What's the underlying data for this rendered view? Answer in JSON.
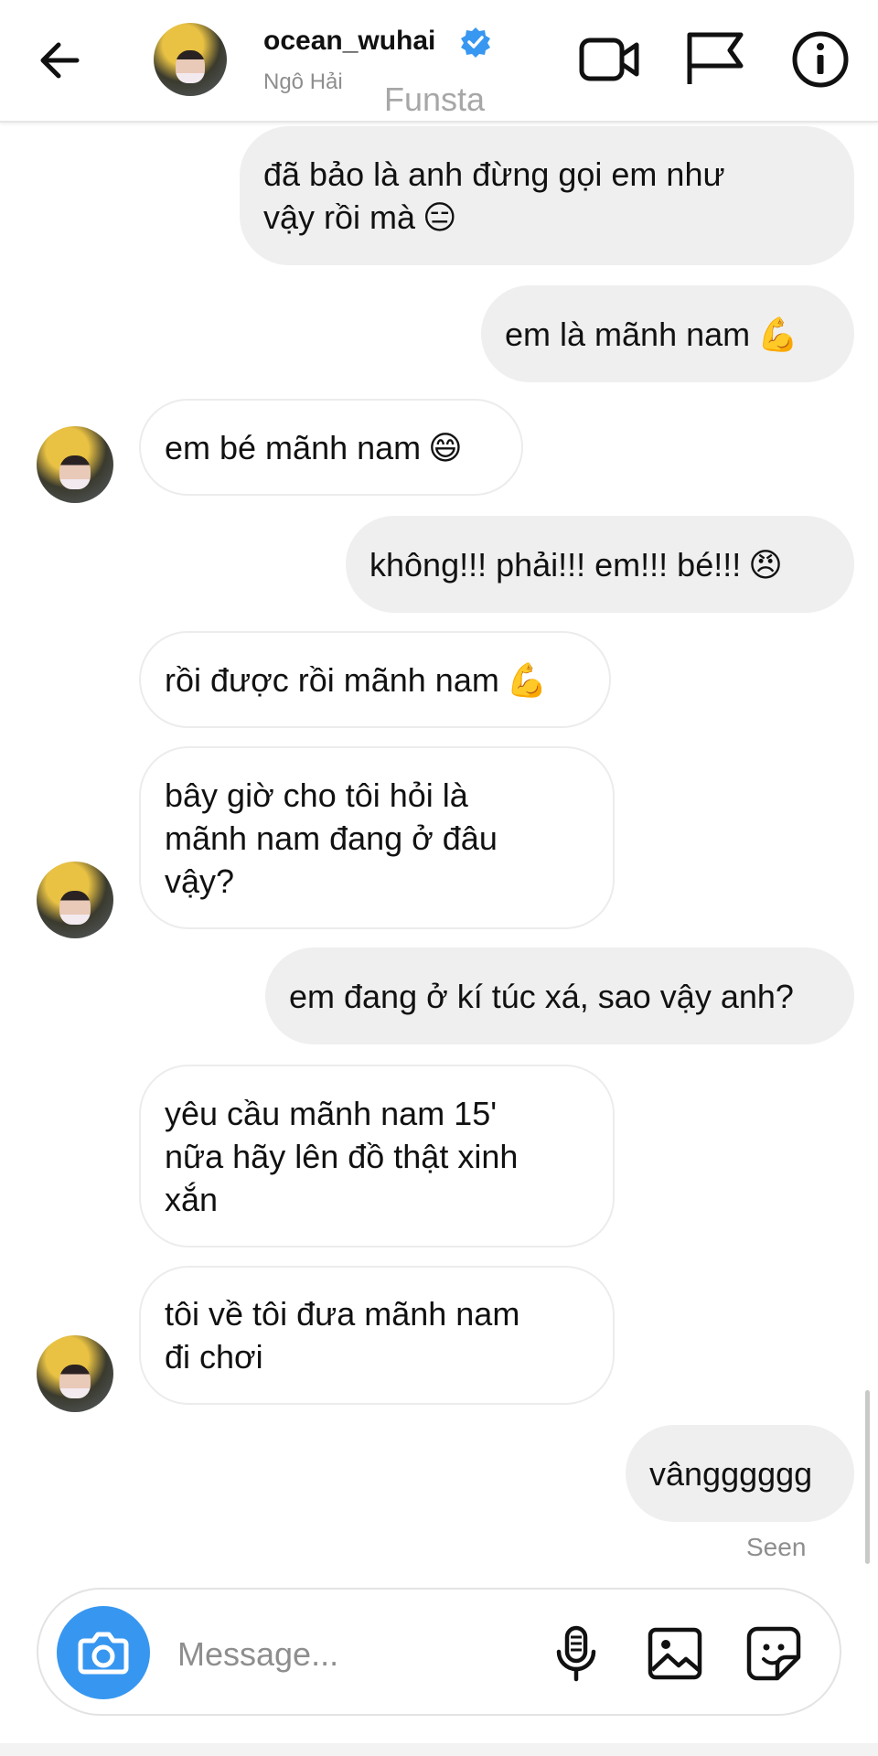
{
  "header": {
    "username": "ocean_wuhai",
    "full_name": "Ngô Hải",
    "watermark": "Funsta",
    "icons": [
      "back-arrow-icon",
      "verified-badge-icon",
      "video-call-icon",
      "flag-icon",
      "info-icon"
    ]
  },
  "messages": [
    {
      "from": "me",
      "text_lines": [
        "đã bảo là anh đừng gọi em như",
        "vậy rồi mà"
      ],
      "emoji": "😑"
    },
    {
      "from": "me",
      "text": "em là mãnh nam",
      "emoji": "💪"
    },
    {
      "from": "them",
      "text": "em bé mãnh nam",
      "emoji": "😄"
    },
    {
      "from": "me",
      "text": "không!!! phải!!! em!!! bé!!!",
      "emoji": "😠"
    },
    {
      "from": "them",
      "text": "rồi được rồi mãnh nam",
      "emoji": "💪"
    },
    {
      "from": "them",
      "text_lines": [
        "bây giờ cho tôi hỏi là",
        "mãnh nam đang ở đâu",
        "vậy?"
      ]
    },
    {
      "from": "me",
      "text": "em đang ở kí túc xá, sao vậy anh?"
    },
    {
      "from": "them",
      "text_lines": [
        "yêu cầu mãnh nam 15'",
        "nữa hãy lên đồ thật xinh",
        "xắn"
      ]
    },
    {
      "from": "them",
      "text_lines": [
        "tôi về tôi đưa mãnh nam",
        "đi chơi"
      ]
    },
    {
      "from": "me",
      "text": "vângggggg"
    }
  ],
  "status": {
    "seen": "Seen"
  },
  "composer": {
    "placeholder": "Message...",
    "icons": [
      "camera-icon",
      "microphone-icon",
      "gallery-icon",
      "sticker-icon"
    ]
  },
  "colors": {
    "accent": "#3797f0",
    "verified": "#3897f0",
    "outgoing_bubble": "#efefef",
    "incoming_border": "#ececec"
  }
}
